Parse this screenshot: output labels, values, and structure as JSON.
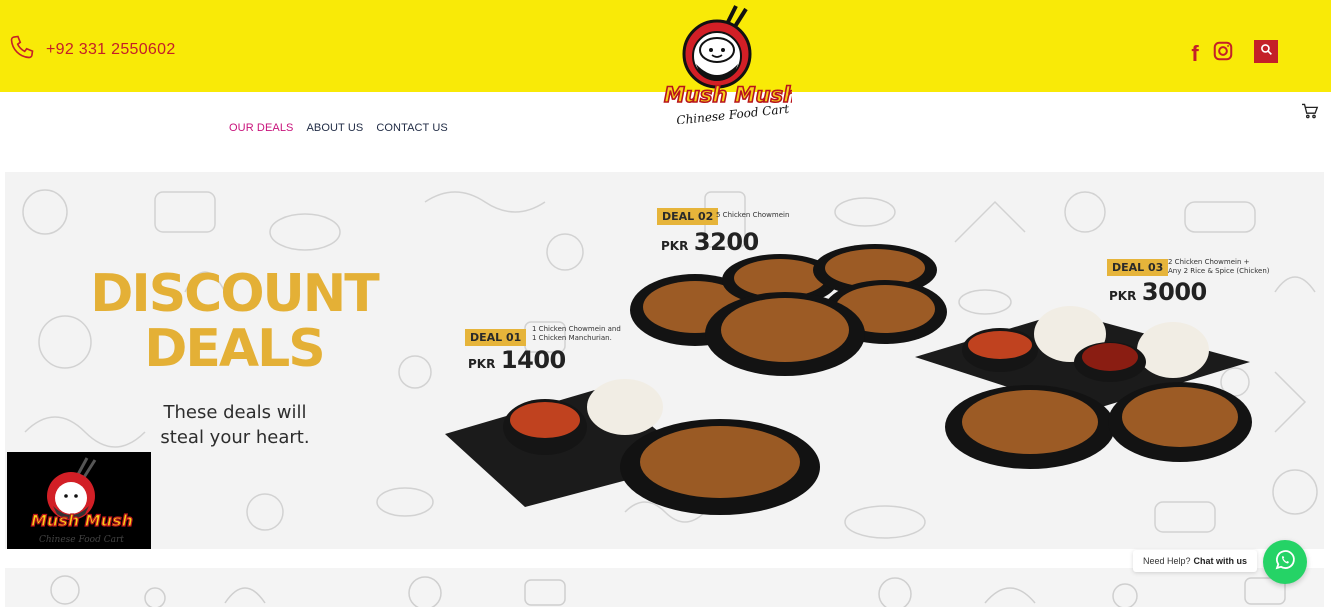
{
  "header": {
    "phone": "+92 331 2550602",
    "brand_name": "Mush Mush",
    "brand_tagline": "Chinese Food Cart"
  },
  "nav": {
    "items": [
      {
        "label": "OUR DEALS",
        "active": true
      },
      {
        "label": "ABOUT US",
        "active": false
      },
      {
        "label": "CONTACT US",
        "active": false
      }
    ]
  },
  "hero": {
    "title_line1": "DISCOUNT",
    "title_line2": "DEALS",
    "subtitle_line1": "These deals will",
    "subtitle_line2": "steal your heart.",
    "deals": [
      {
        "tag": "DEAL 01",
        "desc_line1": "1 Chicken Chowmein and",
        "desc_line2": "1 Chicken Manchurian.",
        "currency": "PKR",
        "price": "1400"
      },
      {
        "tag": "DEAL 02",
        "desc_line1": "5 Chicken Chowmein",
        "desc_line2": "",
        "currency": "PKR",
        "price": "3200"
      },
      {
        "tag": "DEAL 03",
        "desc_line1": "2 Chicken Chowmein +",
        "desc_line2": "Any 2 Rice & Spice (Chicken)",
        "currency": "PKR",
        "price": "3000"
      }
    ]
  },
  "chat": {
    "prompt": "Need Help?",
    "action": "Chat with us"
  },
  "icons": {
    "phone": "phone-icon",
    "facebook": "facebook-icon",
    "instagram": "instagram-icon",
    "search": "search-icon",
    "cart": "cart-icon",
    "whatsapp": "whatsapp-icon"
  },
  "colors": {
    "topbar": "#f9ea07",
    "accent_red": "#c42028",
    "nav_active": "#c8127b",
    "nav_text": "#1f2a44",
    "deal_gold": "#e4b036",
    "whatsapp": "#25d366"
  }
}
